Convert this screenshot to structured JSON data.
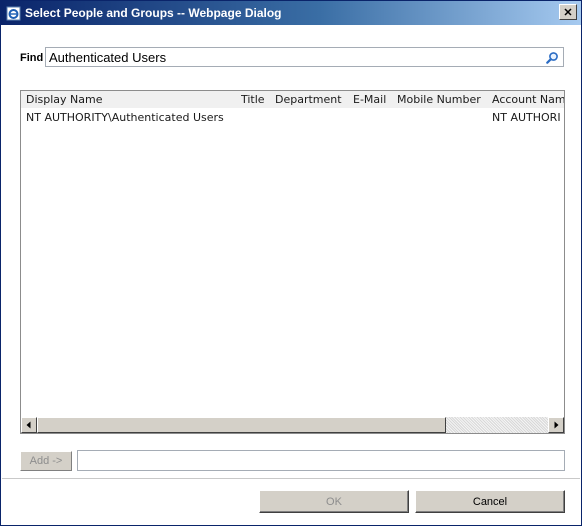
{
  "window": {
    "title": "Select People and Groups -- Webpage Dialog",
    "close_label": "✕"
  },
  "find": {
    "label": "Find",
    "value": "Authenticated Users"
  },
  "results": {
    "columns": [
      "Display Name",
      "Title",
      "Department",
      "E-Mail",
      "Mobile Number",
      "Account Nam"
    ],
    "rows": [
      [
        "NT AUTHORITY\\Authenticated Users",
        "",
        "",
        "",
        "",
        "NT AUTHORI"
      ]
    ]
  },
  "add": {
    "label": "Add ->",
    "value": ""
  },
  "buttons": {
    "ok_label": "OK",
    "cancel_label": "Cancel"
  },
  "icons": {
    "app": "ie-page-icon",
    "search": "search-icon",
    "scroll_left": "arrow-left-icon",
    "scroll_right": "arrow-right-icon"
  },
  "colors": {
    "titlebar_start": "#0a246a",
    "titlebar_end": "#a6caf0",
    "button_face": "#d4d0c8",
    "disabled_text": "#8d8d8d"
  }
}
